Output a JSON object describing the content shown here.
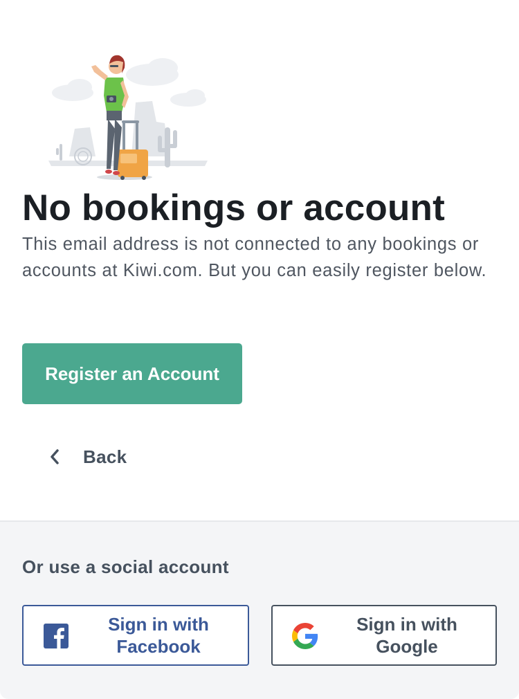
{
  "header": {
    "title": "No bookings or account",
    "description": "This email address is not connected to any bookings or accounts at Kiwi.com. But you can easily register below."
  },
  "actions": {
    "register_label": "Register an Account",
    "back_label": "Back"
  },
  "social": {
    "heading": "Or use a social account",
    "facebook_line1": "Sign in with",
    "facebook_line2": "Facebook",
    "google_line1": "Sign in with",
    "google_line2": "Google"
  },
  "colors": {
    "primary_button": "#4ba88f",
    "facebook": "#3b5998",
    "social_background": "#f4f5f7"
  },
  "icons": {
    "illustration": "traveler-with-suitcase-illustration",
    "back": "chevron-left-icon",
    "facebook": "facebook-icon",
    "google": "google-icon"
  }
}
